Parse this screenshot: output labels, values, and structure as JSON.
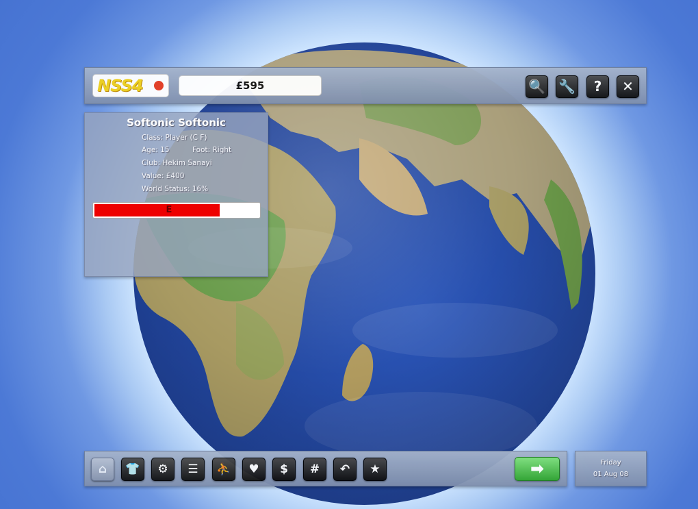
{
  "header": {
    "logo_text": "NSS4",
    "balance": "£595",
    "buttons": [
      {
        "name": "search",
        "glyph": "🔍"
      },
      {
        "name": "settings",
        "glyph": "🔧"
      },
      {
        "name": "help",
        "glyph": "?"
      },
      {
        "name": "close",
        "glyph": "✕"
      }
    ]
  },
  "player": {
    "name": "Softonic Softonic",
    "class": "Class: Player (C F)",
    "age": "Age: 15",
    "foot": "Foot: Right",
    "club": "Club: Hekim Sanayi",
    "value": "Value: £400",
    "world_status": "World Status: 16%",
    "energy_label": "E",
    "energy_fraction": 0.75
  },
  "toolbar": {
    "buttons": [
      {
        "name": "home",
        "glyph": "⌂"
      },
      {
        "name": "kit",
        "glyph": "👕"
      },
      {
        "name": "network",
        "glyph": "⚙"
      },
      {
        "name": "list",
        "glyph": "☰"
      },
      {
        "name": "training",
        "glyph": "⛹"
      },
      {
        "name": "relationship",
        "glyph": "♥"
      },
      {
        "name": "finance",
        "glyph": "$"
      },
      {
        "name": "stats",
        "glyph": "#"
      },
      {
        "name": "transfer",
        "glyph": "↶"
      },
      {
        "name": "favorites",
        "glyph": "★"
      }
    ],
    "continue_glyph": "➡"
  },
  "date": {
    "day": "Friday",
    "date": "01 Aug 08"
  },
  "colors": {
    "energy": "#ee0000",
    "continue": "#2fa42e"
  }
}
